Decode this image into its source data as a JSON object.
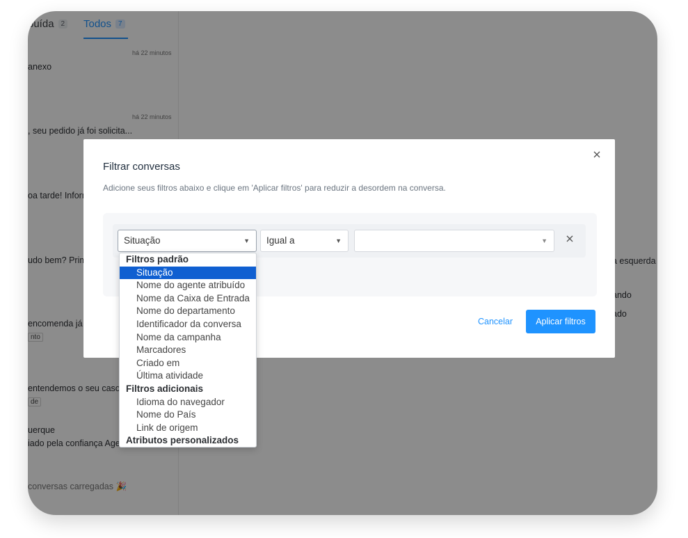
{
  "tabs": [
    {
      "label": "buída",
      "count": "2"
    },
    {
      "label": "Todos",
      "count": "7"
    }
  ],
  "conversations": {
    "c1_time": "há 22 minutos",
    "c1_preview": "anexo",
    "c2_time": "há 22 minutos",
    "c2_preview": ", seu pedido já foi solicita...",
    "c3_preview": "oa tarde! Inform",
    "c4_preview": "udo bem? Prime",
    "c5_preview": "encomenda já",
    "c5_tag": "nto",
    "c6_preview": "entendemos o seu caso",
    "c6_tag": "de",
    "c7_name": "uerque",
    "c7_preview": "iado pela confiança Age",
    "loaded": "conversas carregadas 🎉"
  },
  "right_panel": {
    "line1": "a esquerda",
    "line2": "ando",
    "line3": "ado"
  },
  "modal": {
    "title": "Filtrar conversas",
    "description": "Adicione seus filtros abaixo e clique em 'Aplicar filtros' para reduzir a desordem na conversa.",
    "attribute_value": "Situação",
    "operator_value": "Igual a",
    "value_value": "",
    "cancel_label": "Cancelar",
    "apply_label": "Aplicar filtros",
    "close_icon": "close-icon",
    "remove_icon": "close-icon"
  },
  "dropdown": {
    "groups": [
      {
        "label": "Filtros padrão",
        "options": [
          "Situação",
          "Nome do agente atribuído",
          "Nome da Caixa de Entrada",
          "Nome do departamento",
          "Identificador da conversa",
          "Nome da campanha",
          "Marcadores",
          "Criado em",
          "Última atividade"
        ]
      },
      {
        "label": "Filtros adicionais",
        "options": [
          "Idioma do navegador",
          "Nome do País",
          "Link de origem"
        ]
      },
      {
        "label": "Atributos personalizados",
        "options": []
      }
    ],
    "selected": "Situação"
  },
  "colors": {
    "accent": "#1f93ff",
    "selected_option": "#0f5fd1",
    "overlay": "rgba(0,0,0,0.45)"
  }
}
